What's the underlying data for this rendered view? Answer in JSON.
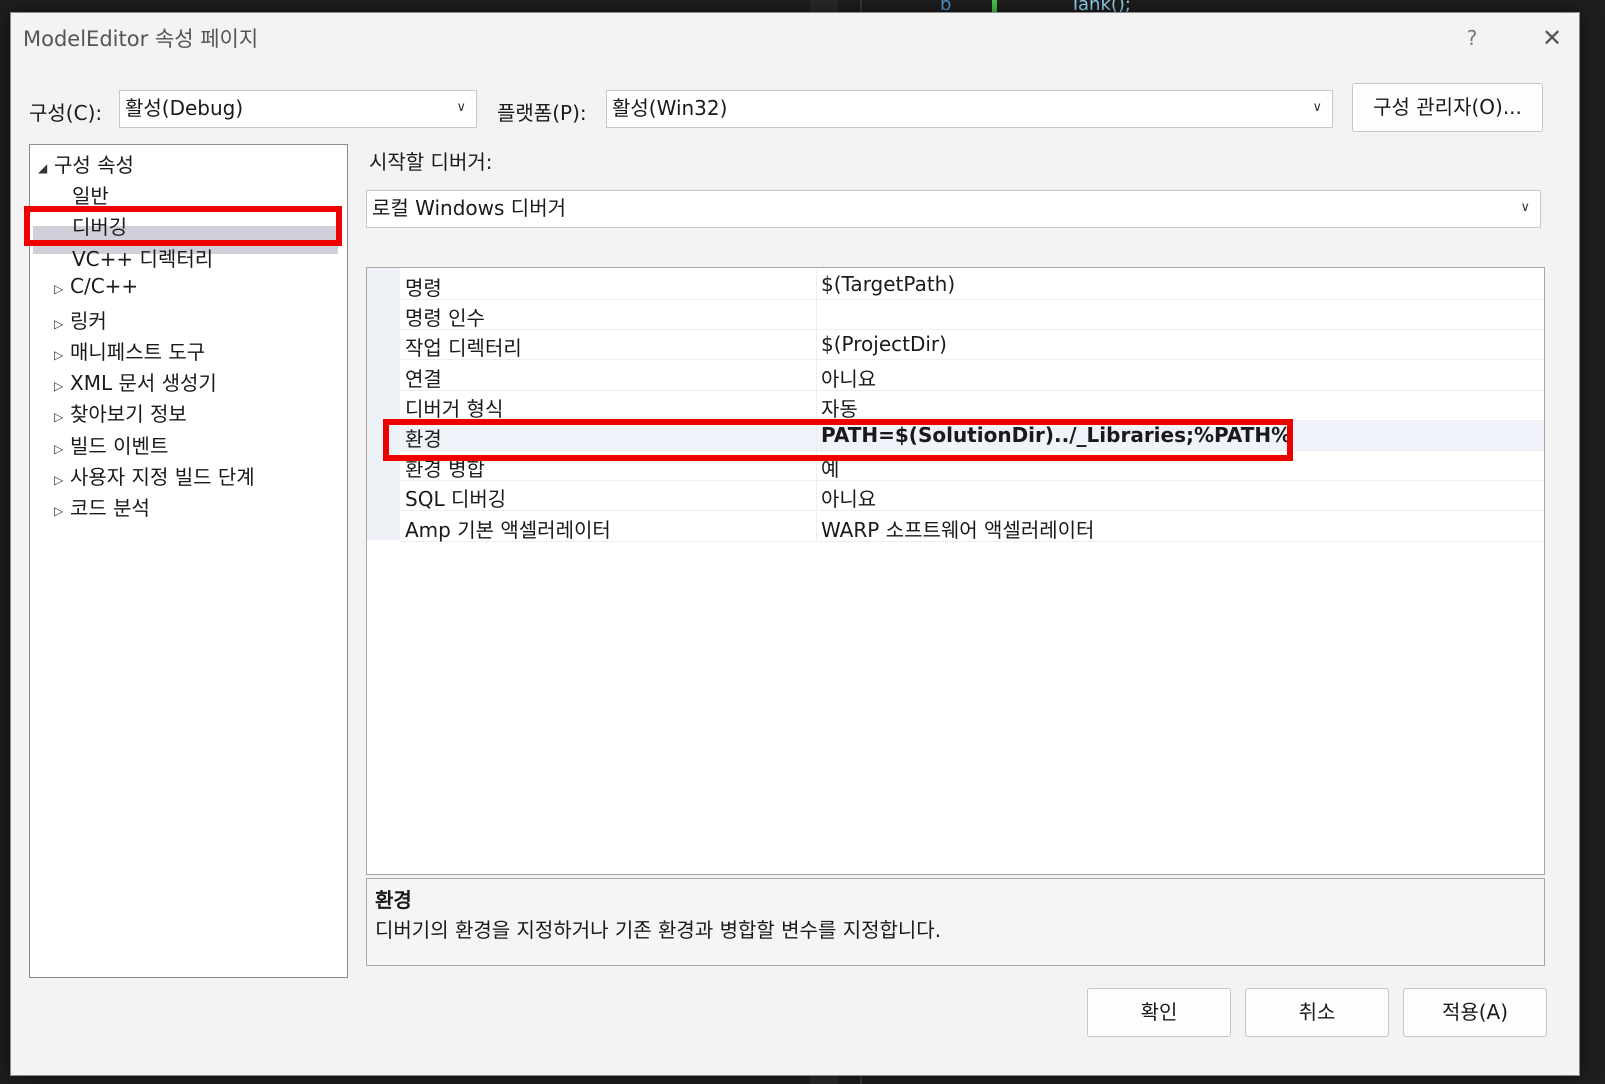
{
  "window": {
    "title": "ModelEditor 속성 페이지",
    "help": "?",
    "close": "✕"
  },
  "toolbar": {
    "config_label": "구성(C):",
    "config_value": "활성(Debug)",
    "platform_label": "플랫폼(P):",
    "platform_value": "활성(Win32)",
    "manage_button": "구성 관리자(O)..."
  },
  "tree": {
    "root": "구성 속성",
    "items": [
      {
        "label": "일반",
        "expandable": false
      },
      {
        "label": "디버깅",
        "expandable": false,
        "selected": true
      },
      {
        "label": "VC++ 디렉터리",
        "expandable": false
      },
      {
        "label": "C/C++",
        "expandable": true
      },
      {
        "label": "링커",
        "expandable": true
      },
      {
        "label": "매니페스트 도구",
        "expandable": true
      },
      {
        "label": "XML 문서 생성기",
        "expandable": true
      },
      {
        "label": "찾아보기 정보",
        "expandable": true
      },
      {
        "label": "빌드 이벤트",
        "expandable": true
      },
      {
        "label": "사용자 지정 빌드 단계",
        "expandable": true
      },
      {
        "label": "코드 분석",
        "expandable": true
      }
    ]
  },
  "debugger": {
    "label": "시작할 디버거:",
    "value": "로컬 Windows 디버거"
  },
  "properties": [
    {
      "name": "명령",
      "value": "$(TargetPath)"
    },
    {
      "name": "명령 인수",
      "value": ""
    },
    {
      "name": "작업 디렉터리",
      "value": "$(ProjectDir)"
    },
    {
      "name": "연결",
      "value": "아니요"
    },
    {
      "name": "디버거 형식",
      "value": "자동"
    },
    {
      "name": "환경",
      "value": "PATH=$(SolutionDir)../_Libraries;%PATH%",
      "selected": true
    },
    {
      "name": "환경 병합",
      "value": "예"
    },
    {
      "name": "SQL 디버깅",
      "value": "아니요"
    },
    {
      "name": "Amp 기본 액셀러레이터",
      "value": "WARP 소프트웨어 액셀러레이터"
    }
  ],
  "description": {
    "title": "환경",
    "text": "디버기의 환경을 지정하거나 기존 환경과 병합할 변수를 지정합니다."
  },
  "buttons": {
    "ok": "확인",
    "cancel": "취소",
    "apply": "적용(A)"
  },
  "background_snippet": {
    "a": "b",
    "b": "Tank();"
  },
  "colors": {
    "highlight_box": "#ee0000",
    "tree_selection": "#cfd0da"
  }
}
